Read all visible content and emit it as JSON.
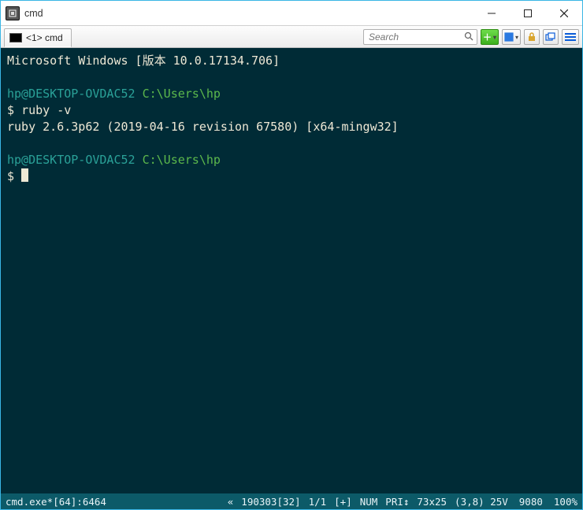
{
  "window": {
    "title": "cmd"
  },
  "tab": {
    "label": "<1> cmd"
  },
  "search": {
    "placeholder": "Search"
  },
  "terminal": {
    "line1": "Microsoft Windows [版本 10.0.17134.706]",
    "prompt1_userhost": "hp@DESKTOP-OVDAC52",
    "prompt1_path": "C:\\Users\\hp",
    "prompt1_symbol": "$",
    "cmd1": "ruby -v",
    "out1": "ruby 2.6.3p62 (2019-04-16 revision 67580) [x64-mingw32]",
    "prompt2_userhost": "hp@DESKTOP-OVDAC52",
    "prompt2_path": "C:\\Users\\hp",
    "prompt2_symbol": "$"
  },
  "status": {
    "proc": "cmd.exe*[64]:6464",
    "chev": "«",
    "date": "190303[32]",
    "line": "1/1",
    "plus": "[+]",
    "num": "NUM",
    "pri": "PRI↕",
    "size": "73x25",
    "pos": "(3,8) 25V",
    "pid": "9080",
    "zoom": "100%"
  }
}
